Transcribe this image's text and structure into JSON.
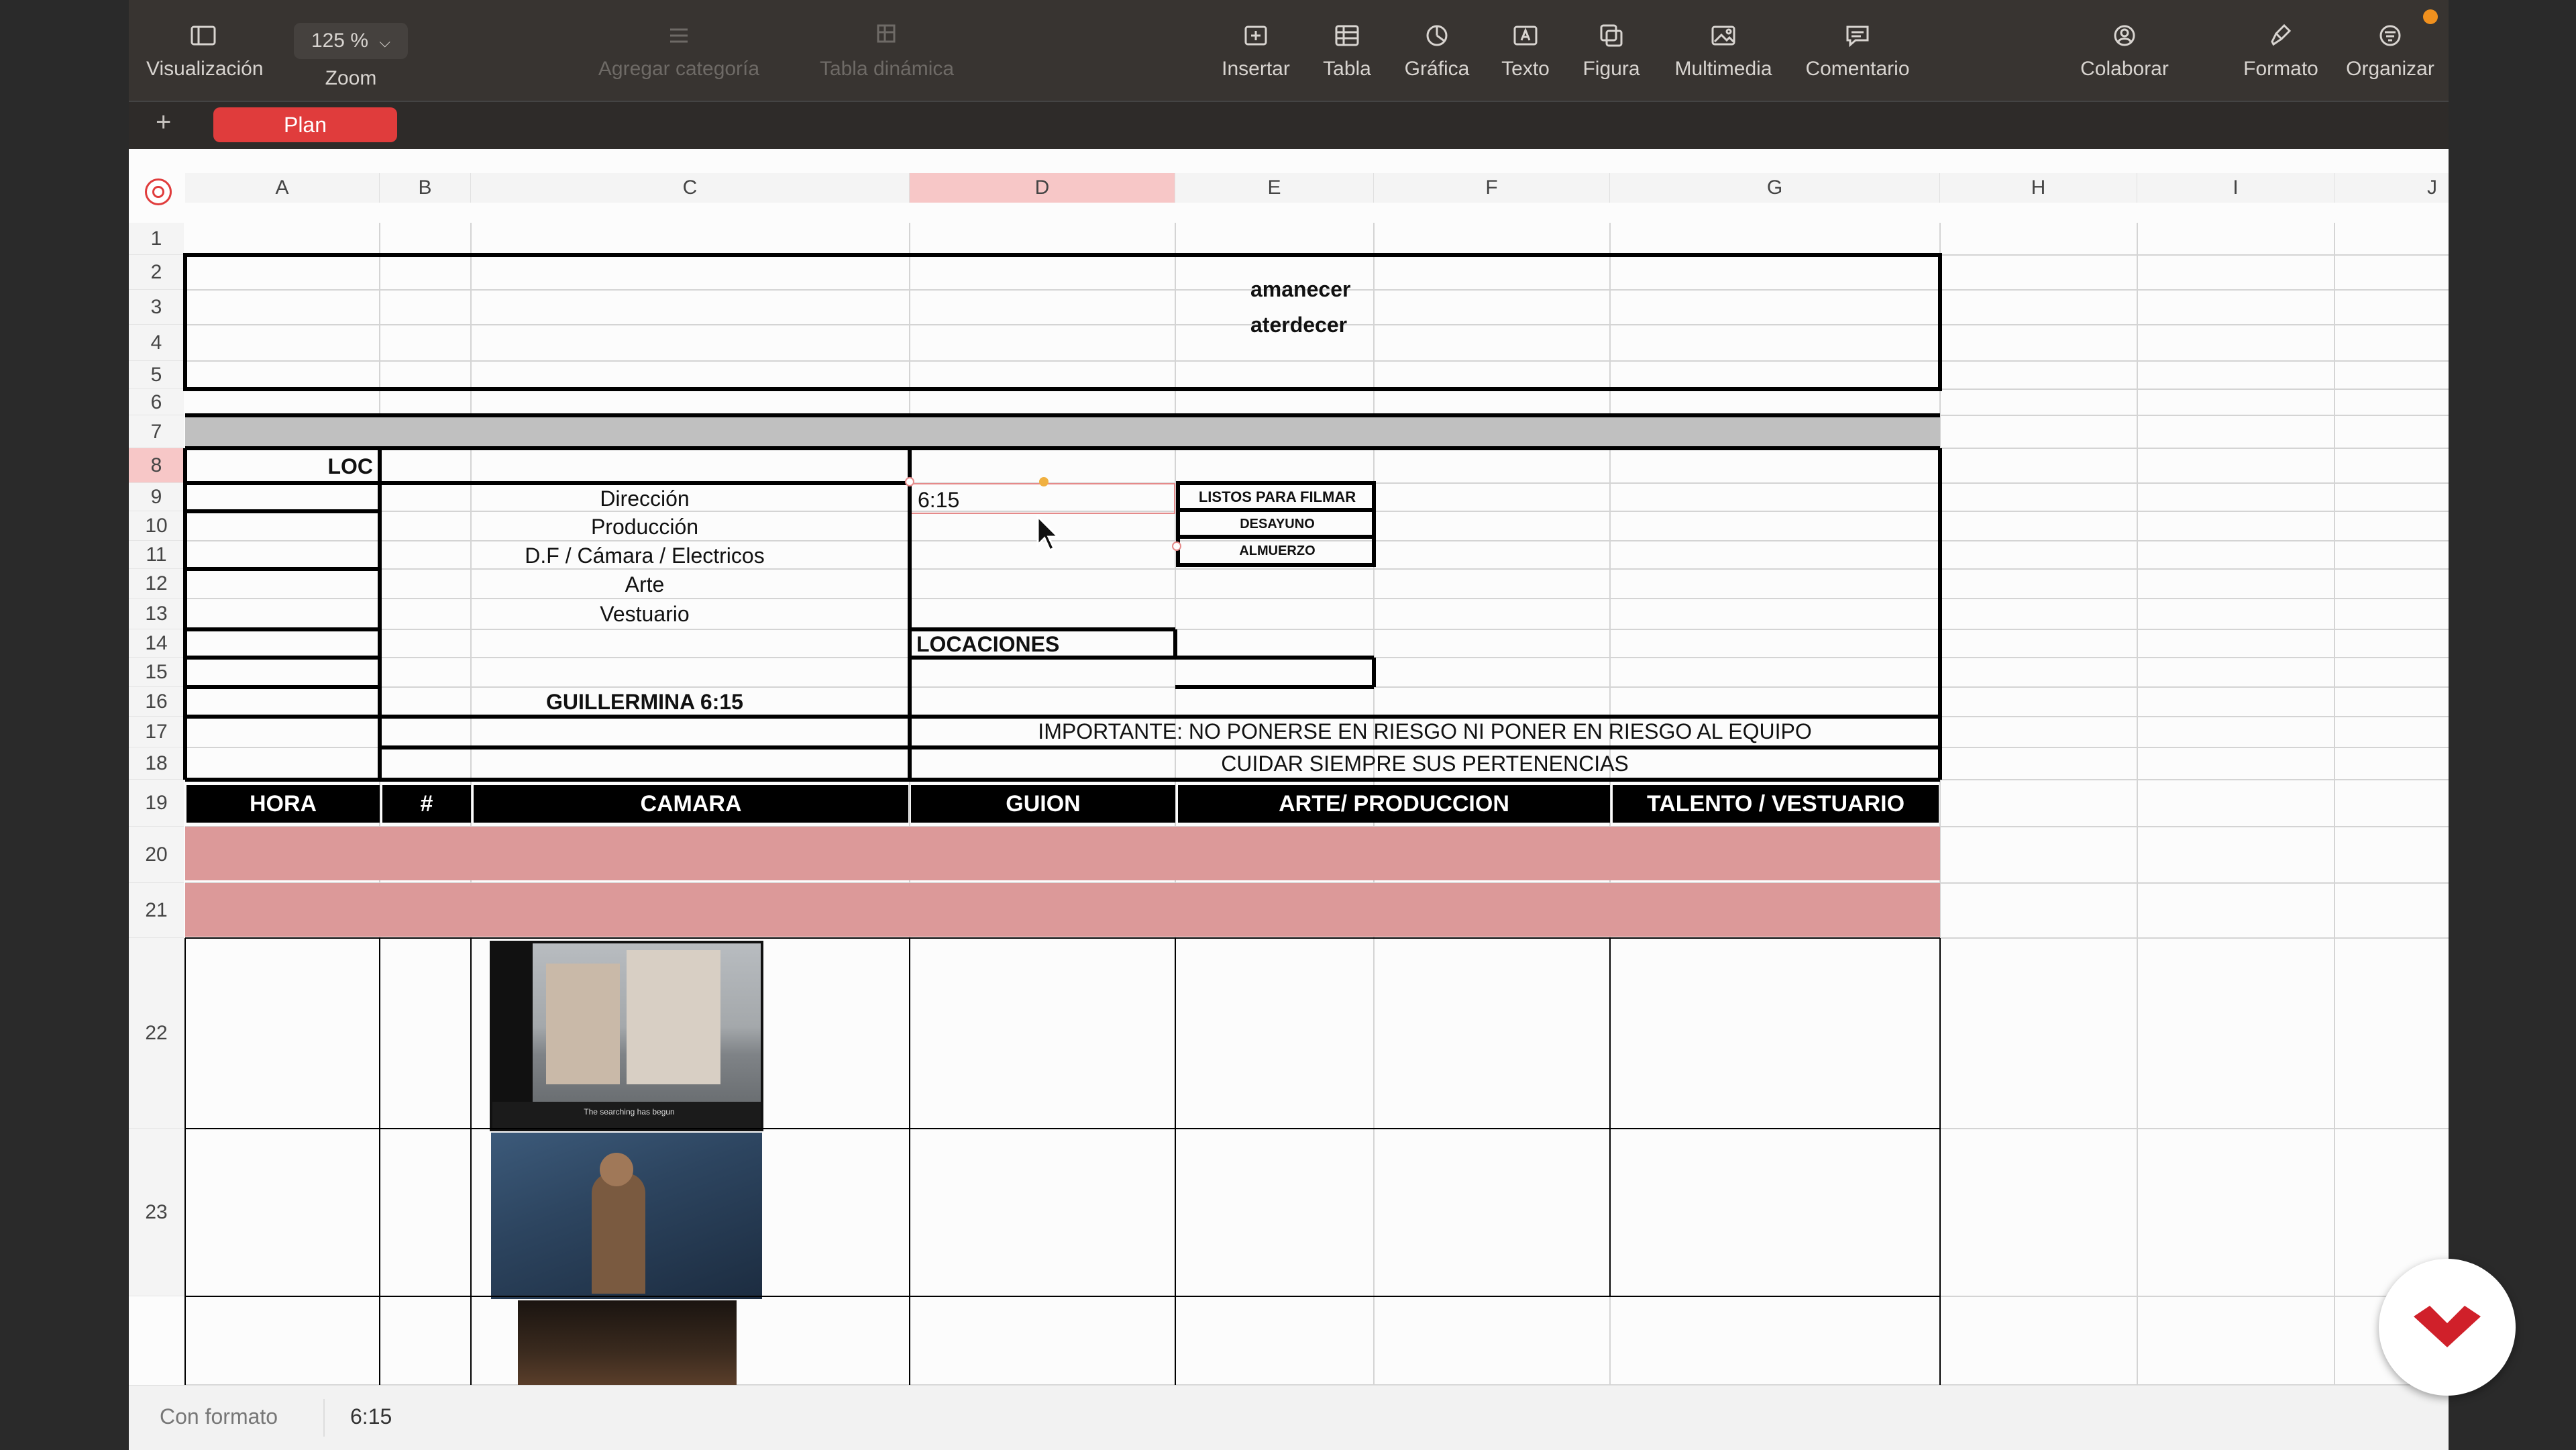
{
  "toolbar": {
    "view_label": "Visualización",
    "zoom_label": "Zoom",
    "zoom_value": "125 %",
    "add_category_label": "Agregar categoría",
    "pivot_table_label": "Tabla dinámica",
    "insert_label": "Insertar",
    "table_label": "Tabla",
    "chart_label": "Gráfica",
    "text_label": "Texto",
    "shape_label": "Figura",
    "media_label": "Multimedia",
    "comment_label": "Comentario",
    "collaborate_label": "Colaborar",
    "format_label": "Formato",
    "organize_label": "Organizar"
  },
  "sheets": {
    "add_label": "+",
    "active_tab": "Plan"
  },
  "columns": [
    "A",
    "B",
    "C",
    "D",
    "E",
    "F",
    "G",
    "H",
    "I",
    "J"
  ],
  "selected_column": "D",
  "rows": [
    "1",
    "2",
    "3",
    "4",
    "5",
    "6",
    "7",
    "8",
    "9",
    "10",
    "11",
    "12",
    "13",
    "14",
    "15",
    "16",
    "17",
    "18",
    "19",
    "20",
    "21",
    "22",
    "23"
  ],
  "selected_row": "8",
  "cells": {
    "amanecer": "amanecer",
    "atardecer": "aterdecer",
    "loc": "LOC",
    "direccion": "Dirección",
    "produccion": "Producción",
    "df_camara": "D.F / Cámara / Electricos",
    "arte": "Arte",
    "vestuario": "Vestuario",
    "selected_time": "6:15",
    "listos": "LISTOS PARA FILMAR",
    "desayuno": "DESAYUNO",
    "almuerzo": "ALMUERZO",
    "locaciones": "LOCACIONES",
    "guillermina": "GUILLERMINA 6:15",
    "importante": "IMPORTANTE: NO PONERSE EN RIESGO NI PONER EN RIESGO AL EQUIPO",
    "cuidar": "CUIDAR SIEMPRE SUS PERTENENCIAS"
  },
  "table_headers": [
    "HORA",
    "#",
    "CAMARA",
    "GUION",
    "ARTE/ PRODUCCION",
    "TALENTO / VESTUARIO"
  ],
  "thumbnail_caption": "The searching has begun",
  "status": {
    "format_label": "Con formato",
    "cell_value": "6:15"
  },
  "colors": {
    "accent": "#e03c3c",
    "toolbar_bg": "#383431",
    "header_fill": "#000000",
    "pink_fill": "#dc9999",
    "gray_band": "#c0c0c0"
  }
}
